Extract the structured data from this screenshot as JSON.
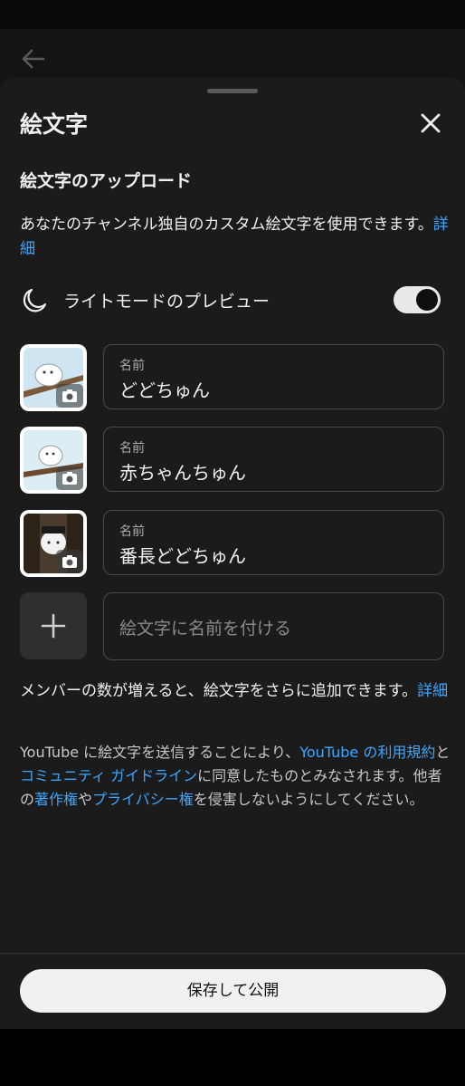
{
  "header": {
    "title": "絵文字",
    "back_icon": "arrow-left-icon",
    "close_icon": "close-icon"
  },
  "upload": {
    "section_title": "絵文字のアップロード",
    "description": "あなたのチャンネル独自のカスタム絵文字を使用できます。",
    "details_link": "詳細"
  },
  "preview": {
    "label": "ライトモードのプレビュー",
    "icon": "moon-icon",
    "toggle_on": true
  },
  "emojis": [
    {
      "name_label": "名前",
      "name_value": "どどちゅん"
    },
    {
      "name_label": "名前",
      "name_value": "赤ちゃんちゅん"
    },
    {
      "name_label": "名前",
      "name_value": "番長どどちゅん"
    }
  ],
  "new_emoji": {
    "placeholder": "絵文字に名前を付ける",
    "add_icon": "plus-icon"
  },
  "member_note": {
    "text": "メンバーの数が増えると、絵文字をさらに追加できます。",
    "details_link": "詳細"
  },
  "terms": {
    "part1": "YouTube に絵文字を送信することにより、",
    "link1": "YouTube の利用規約",
    "part2": "と",
    "link2": "コミュニティ ガイドライン",
    "part3": "に同意したものとみなされます。他者の",
    "link3": "著作権",
    "part4": "や",
    "link4": "プライバシー権",
    "part5": "を侵害しないようにしてください。"
  },
  "footer": {
    "save_label": "保存して公開"
  },
  "colors": {
    "link": "#3ea6ff",
    "sheet_bg": "#1b1b1b",
    "text": "#f1f1f1"
  }
}
